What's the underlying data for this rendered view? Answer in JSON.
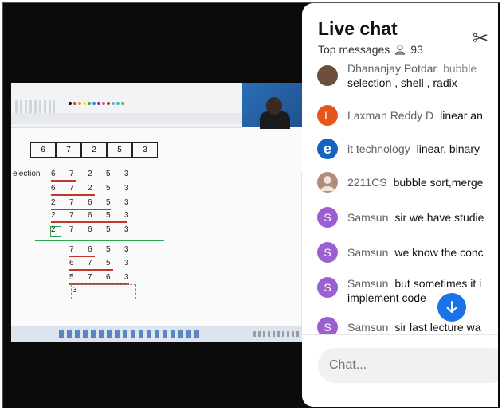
{
  "chat": {
    "title": "Live chat",
    "top_messages_label": "Top messages",
    "viewer_count": "93",
    "input_placeholder": "Chat...",
    "messages": [
      {
        "author": "Dhananjay Potdar",
        "text": "bubble",
        "line2": "selection , shell , radix",
        "avatar_color": "#6b4f3a",
        "avatar_letter": ""
      },
      {
        "author": "Laxman Reddy D",
        "text": "linear an",
        "line2": "",
        "avatar_color": "#e8551b",
        "avatar_letter": "L"
      },
      {
        "author": "it technology",
        "text": "linear, binary",
        "line2": "",
        "avatar_color": "#1565c0",
        "avatar_letter": "e"
      },
      {
        "author": "2211CS",
        "text": "bubble sort,merge",
        "line2": "",
        "avatar_color": "#b08c7a",
        "avatar_letter": ""
      },
      {
        "author": "Samsun",
        "text": "sir we have studie",
        "line2": "",
        "avatar_color": "#9c5fd0",
        "avatar_letter": "S"
      },
      {
        "author": "Samsun",
        "text": "we know the conc",
        "line2": "",
        "avatar_color": "#9c5fd0",
        "avatar_letter": "S"
      },
      {
        "author": "Samsun",
        "text": "but sometimes it i",
        "line2": "implement code",
        "avatar_color": "#9c5fd0",
        "avatar_letter": "S"
      },
      {
        "author": "Samsun",
        "text": "sir last lecture wa",
        "line2": "",
        "avatar_color": "#9c5fd0",
        "avatar_letter": "S"
      }
    ]
  },
  "video": {
    "array": [
      "6",
      "7",
      "2",
      "5",
      "3"
    ],
    "section_label": "election",
    "rows": [
      [
        "6",
        "7",
        "2",
        "5",
        "3"
      ],
      [
        "6",
        "7",
        "2",
        "5",
        "3"
      ],
      [
        "2",
        "7",
        "6",
        "5",
        "3"
      ],
      [
        "2",
        "7",
        "6",
        "5",
        "3"
      ],
      [
        "2",
        "7",
        "6",
        "5",
        "3"
      ],
      [
        "7",
        "6",
        "5",
        "3"
      ],
      [
        "6",
        "7",
        "5",
        "3"
      ],
      [
        "5",
        "7",
        "6",
        "3"
      ],
      [
        "3"
      ]
    ]
  },
  "icons": {
    "scissors": "scissors-icon",
    "viewers": "person-icon",
    "scroll_down": "arrow-down-icon"
  },
  "colors": {
    "accent": "#1a73e8",
    "underline": "#c0392b",
    "green_line": "#2ea44f"
  }
}
